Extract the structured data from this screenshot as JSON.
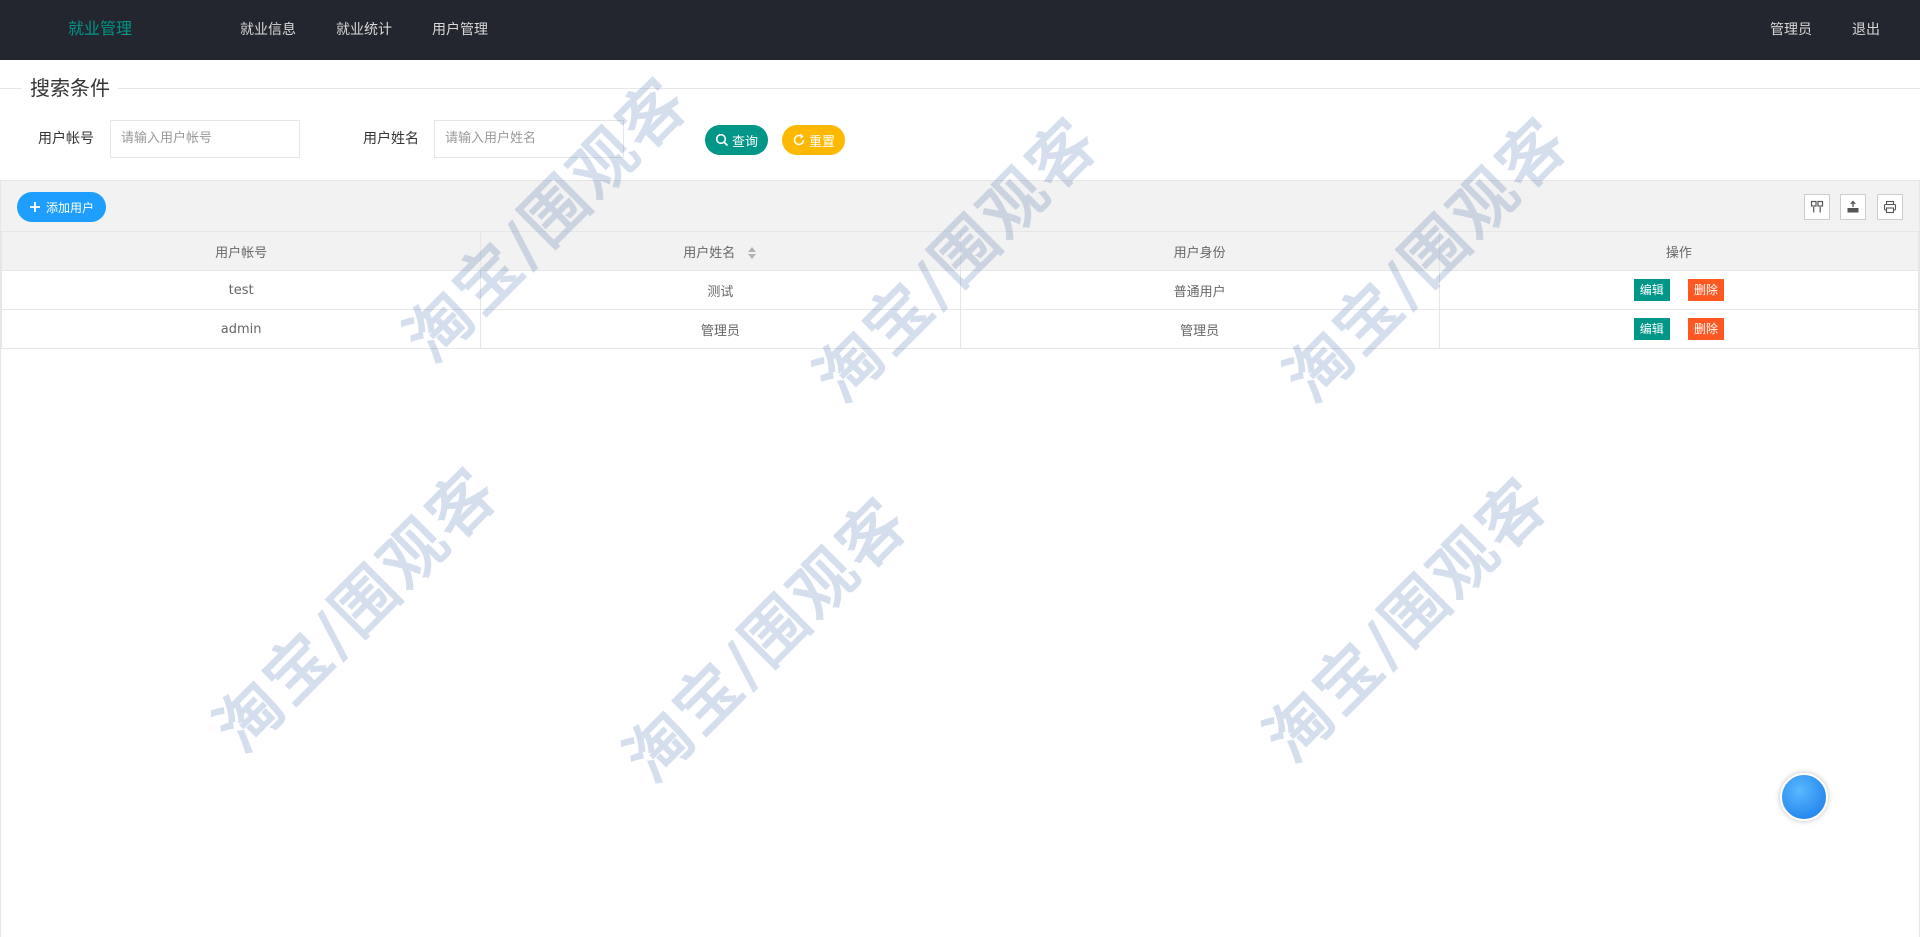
{
  "header": {
    "logo": "就业管理",
    "nav": [
      {
        "label": "就业信息"
      },
      {
        "label": "就业统计"
      },
      {
        "label": "用户管理"
      }
    ],
    "right": [
      {
        "label": "管理员"
      },
      {
        "label": "退出"
      }
    ]
  },
  "search": {
    "legend": "搜索条件",
    "account_label": "用户帐号",
    "account_placeholder": "请输入用户帐号",
    "name_label": "用户姓名",
    "name_placeholder": "请输入用户姓名",
    "query_label": "查询",
    "reset_label": "重置"
  },
  "toolbar": {
    "add_label": "添加用户",
    "icons": [
      "columns-icon",
      "export-icon",
      "print-icon"
    ]
  },
  "table": {
    "headers": [
      "用户帐号",
      "用户姓名",
      "用户身份",
      "操作"
    ],
    "rows": [
      {
        "account": "test",
        "name": "测试",
        "role": "普通用户",
        "edit": "编辑",
        "delete": "删除"
      },
      {
        "account": "admin",
        "name": "管理员",
        "role": "管理员",
        "edit": "编辑",
        "delete": "删除"
      }
    ]
  },
  "watermark": "淘宝/围观客",
  "colors": {
    "header_bg": "#23262e",
    "logo": "#009688",
    "primary": "#009688",
    "warm": "#ffb800",
    "normal": "#1e9fff",
    "danger": "#ff5722"
  }
}
